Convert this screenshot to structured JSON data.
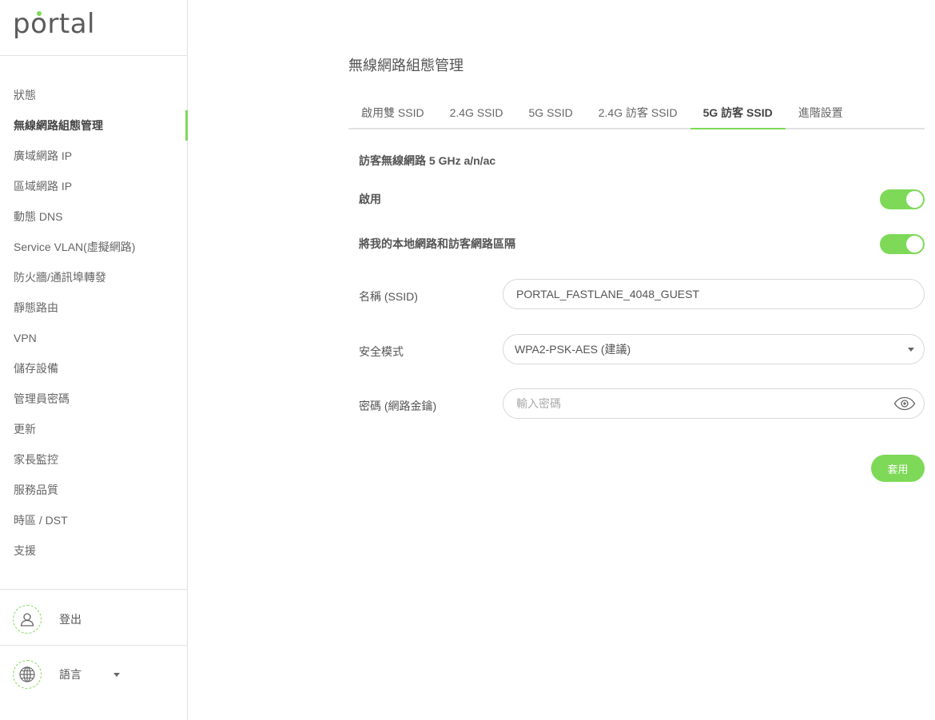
{
  "brand": {
    "logo_text_pre": "p",
    "logo_text_o": "o",
    "logo_text_post": "rtal",
    "accent_color": "#7dd957"
  },
  "sidebar": {
    "items": [
      {
        "label": "狀態"
      },
      {
        "label": "無線網路組態管理",
        "active": true
      },
      {
        "label": "廣域網路 IP"
      },
      {
        "label": "區域網路 IP"
      },
      {
        "label": "動態 DNS"
      },
      {
        "label": "Service VLAN(虛擬網路)"
      },
      {
        "label": "防火牆/通訊埠轉發"
      },
      {
        "label": "靜態路由"
      },
      {
        "label": "VPN"
      },
      {
        "label": "儲存設備"
      },
      {
        "label": "管理員密碼"
      },
      {
        "label": "更新"
      },
      {
        "label": "家長監控"
      },
      {
        "label": "服務品質"
      },
      {
        "label": "時區 / DST"
      },
      {
        "label": "支援"
      }
    ],
    "logout_label": "登出",
    "language_label": "語言"
  },
  "main": {
    "title": "無線網路組態管理",
    "tabs": [
      {
        "label": "啟用雙 SSID"
      },
      {
        "label": "2.4G SSID"
      },
      {
        "label": "5G SSID"
      },
      {
        "label": "2.4G 訪客 SSID"
      },
      {
        "label": "5G 訪客 SSID",
        "active": true
      },
      {
        "label": "進階設置"
      }
    ],
    "section_title": "訪客無線網路 5 GHz a/n/ac",
    "enable_label": "啟用",
    "enable_on": true,
    "isolate_label": "將我的本地網路和訪客網路區隔",
    "isolate_on": true,
    "ssid_label": "名稱 (SSID)",
    "ssid_value": "PORTAL_FASTLANE_4048_GUEST",
    "security_label": "安全模式",
    "security_value": "WPA2-PSK-AES (建議)",
    "password_label": "密碼 (網路金鑰)",
    "password_placeholder": "輸入密碼",
    "password_value": "",
    "apply_label": "套用"
  }
}
